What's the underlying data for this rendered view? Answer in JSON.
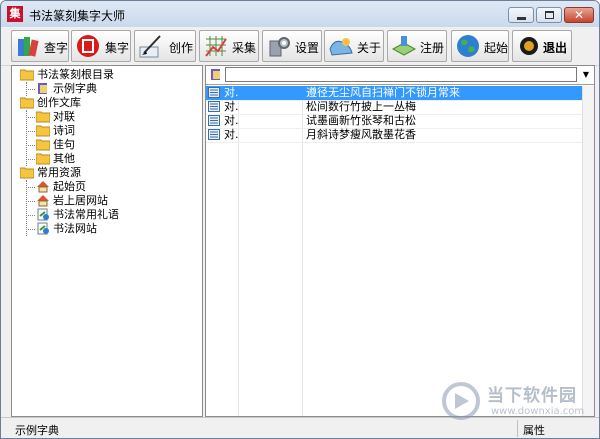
{
  "window": {
    "title": "书法篆刻集字大师",
    "app_icon_glyph": "集",
    "close_glyph": "✕"
  },
  "toolbar": {
    "buttons": [
      {
        "id": "chazi",
        "label": "查字",
        "icon": "books-icon"
      },
      {
        "id": "jizi",
        "label": "集字",
        "icon": "seal-icon"
      },
      {
        "id": "chuangzuo",
        "label": "创作",
        "icon": "brush-icon"
      },
      {
        "id": "caiji",
        "label": "采集",
        "icon": "grid-icon"
      },
      {
        "id": "shezhi",
        "label": "设置",
        "icon": "gear-icon"
      },
      {
        "id": "guanyu",
        "label": "关于",
        "icon": "about-icon"
      },
      {
        "id": "zhuce",
        "label": "注册",
        "icon": "register-icon"
      },
      {
        "id": "qishi",
        "label": "起始",
        "icon": "globe-icon"
      },
      {
        "id": "tuichu",
        "label": "退出",
        "icon": "exit-icon"
      }
    ]
  },
  "tree": {
    "items": [
      {
        "label": "书法篆刻根目录",
        "icon": "folder-icon"
      },
      {
        "label": "示例字典",
        "icon": "book-icon"
      },
      {
        "label": "创作文库",
        "icon": "folder-icon"
      },
      {
        "label": "对联",
        "icon": "folder-icon"
      },
      {
        "label": "诗词",
        "icon": "folder-icon"
      },
      {
        "label": "佳句",
        "icon": "folder-icon"
      },
      {
        "label": "其他",
        "icon": "folder-icon"
      },
      {
        "label": "常用资源",
        "icon": "folder-icon"
      },
      {
        "label": "起始页",
        "icon": "home-icon"
      },
      {
        "label": "岩上居网站",
        "icon": "home-icon"
      },
      {
        "label": "书法常用礼语",
        "icon": "link-icon"
      },
      {
        "label": "书法网站",
        "icon": "link-icon"
      }
    ]
  },
  "list": {
    "rows": [
      {
        "type": "对.",
        "text": "遵径无尘风自扫禅门不锁月常来",
        "selected": true
      },
      {
        "type": "对.",
        "text": "松间数行竹披上一丛梅",
        "selected": false
      },
      {
        "type": "对.",
        "text": "试墨画新竹张琴和古松",
        "selected": false
      },
      {
        "type": "对.",
        "text": "月斜诗梦瘦风散墨花香",
        "selected": false
      }
    ]
  },
  "statusbar": {
    "left": "示例字典",
    "right": "属性"
  },
  "watermark": {
    "brand": "当下软件园",
    "url": "www.downxia.com"
  },
  "colors": {
    "selection": "#3399ff",
    "folder": "#f5c542",
    "close": "#c7442b"
  }
}
